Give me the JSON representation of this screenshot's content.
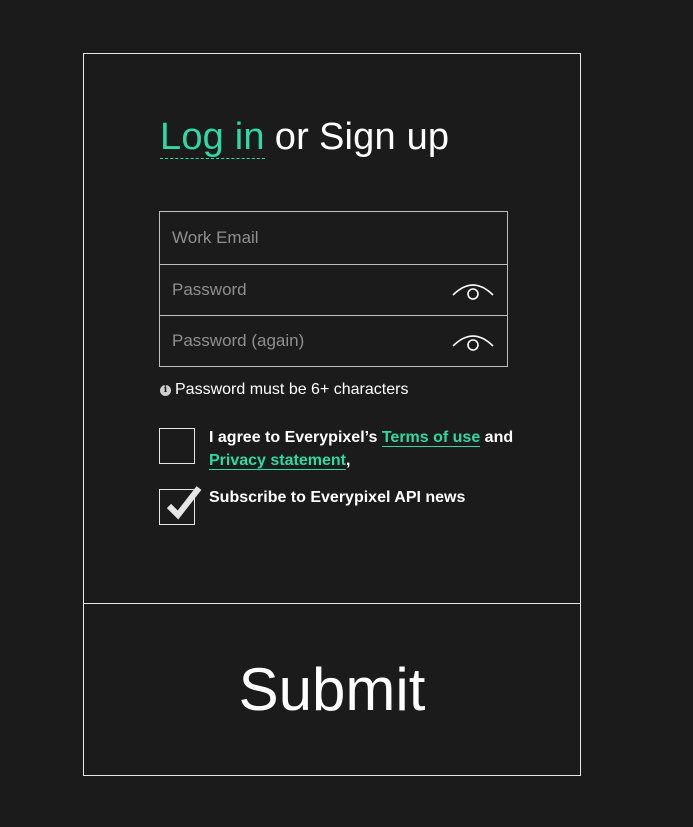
{
  "form": {
    "heading": {
      "login": "Log in",
      "separator": "or",
      "signup": "Sign up"
    },
    "fields": {
      "email": {
        "placeholder": "Work Email",
        "value": ""
      },
      "password": {
        "placeholder": "Password",
        "value": ""
      },
      "password_again": {
        "placeholder": "Password (again)",
        "value": ""
      }
    },
    "hint": {
      "icon": "info-icon",
      "icon_glyph": "i",
      "text": "Password must be 6+ characters"
    },
    "terms": {
      "checked": false,
      "prefix": "I agree to Everypixel’s ",
      "terms_link": "Terms of use",
      "middle": " and ",
      "privacy_link": "Privacy statement",
      "suffix": ","
    },
    "subscribe": {
      "checked": true,
      "label": "Subscribe to Everypixel API news"
    },
    "submit_label": "Submit"
  },
  "colors": {
    "background": "#1b1b1b",
    "accent": "#2fd9a2",
    "border": "#e6e6e6",
    "placeholder": "#8f8f8f"
  }
}
